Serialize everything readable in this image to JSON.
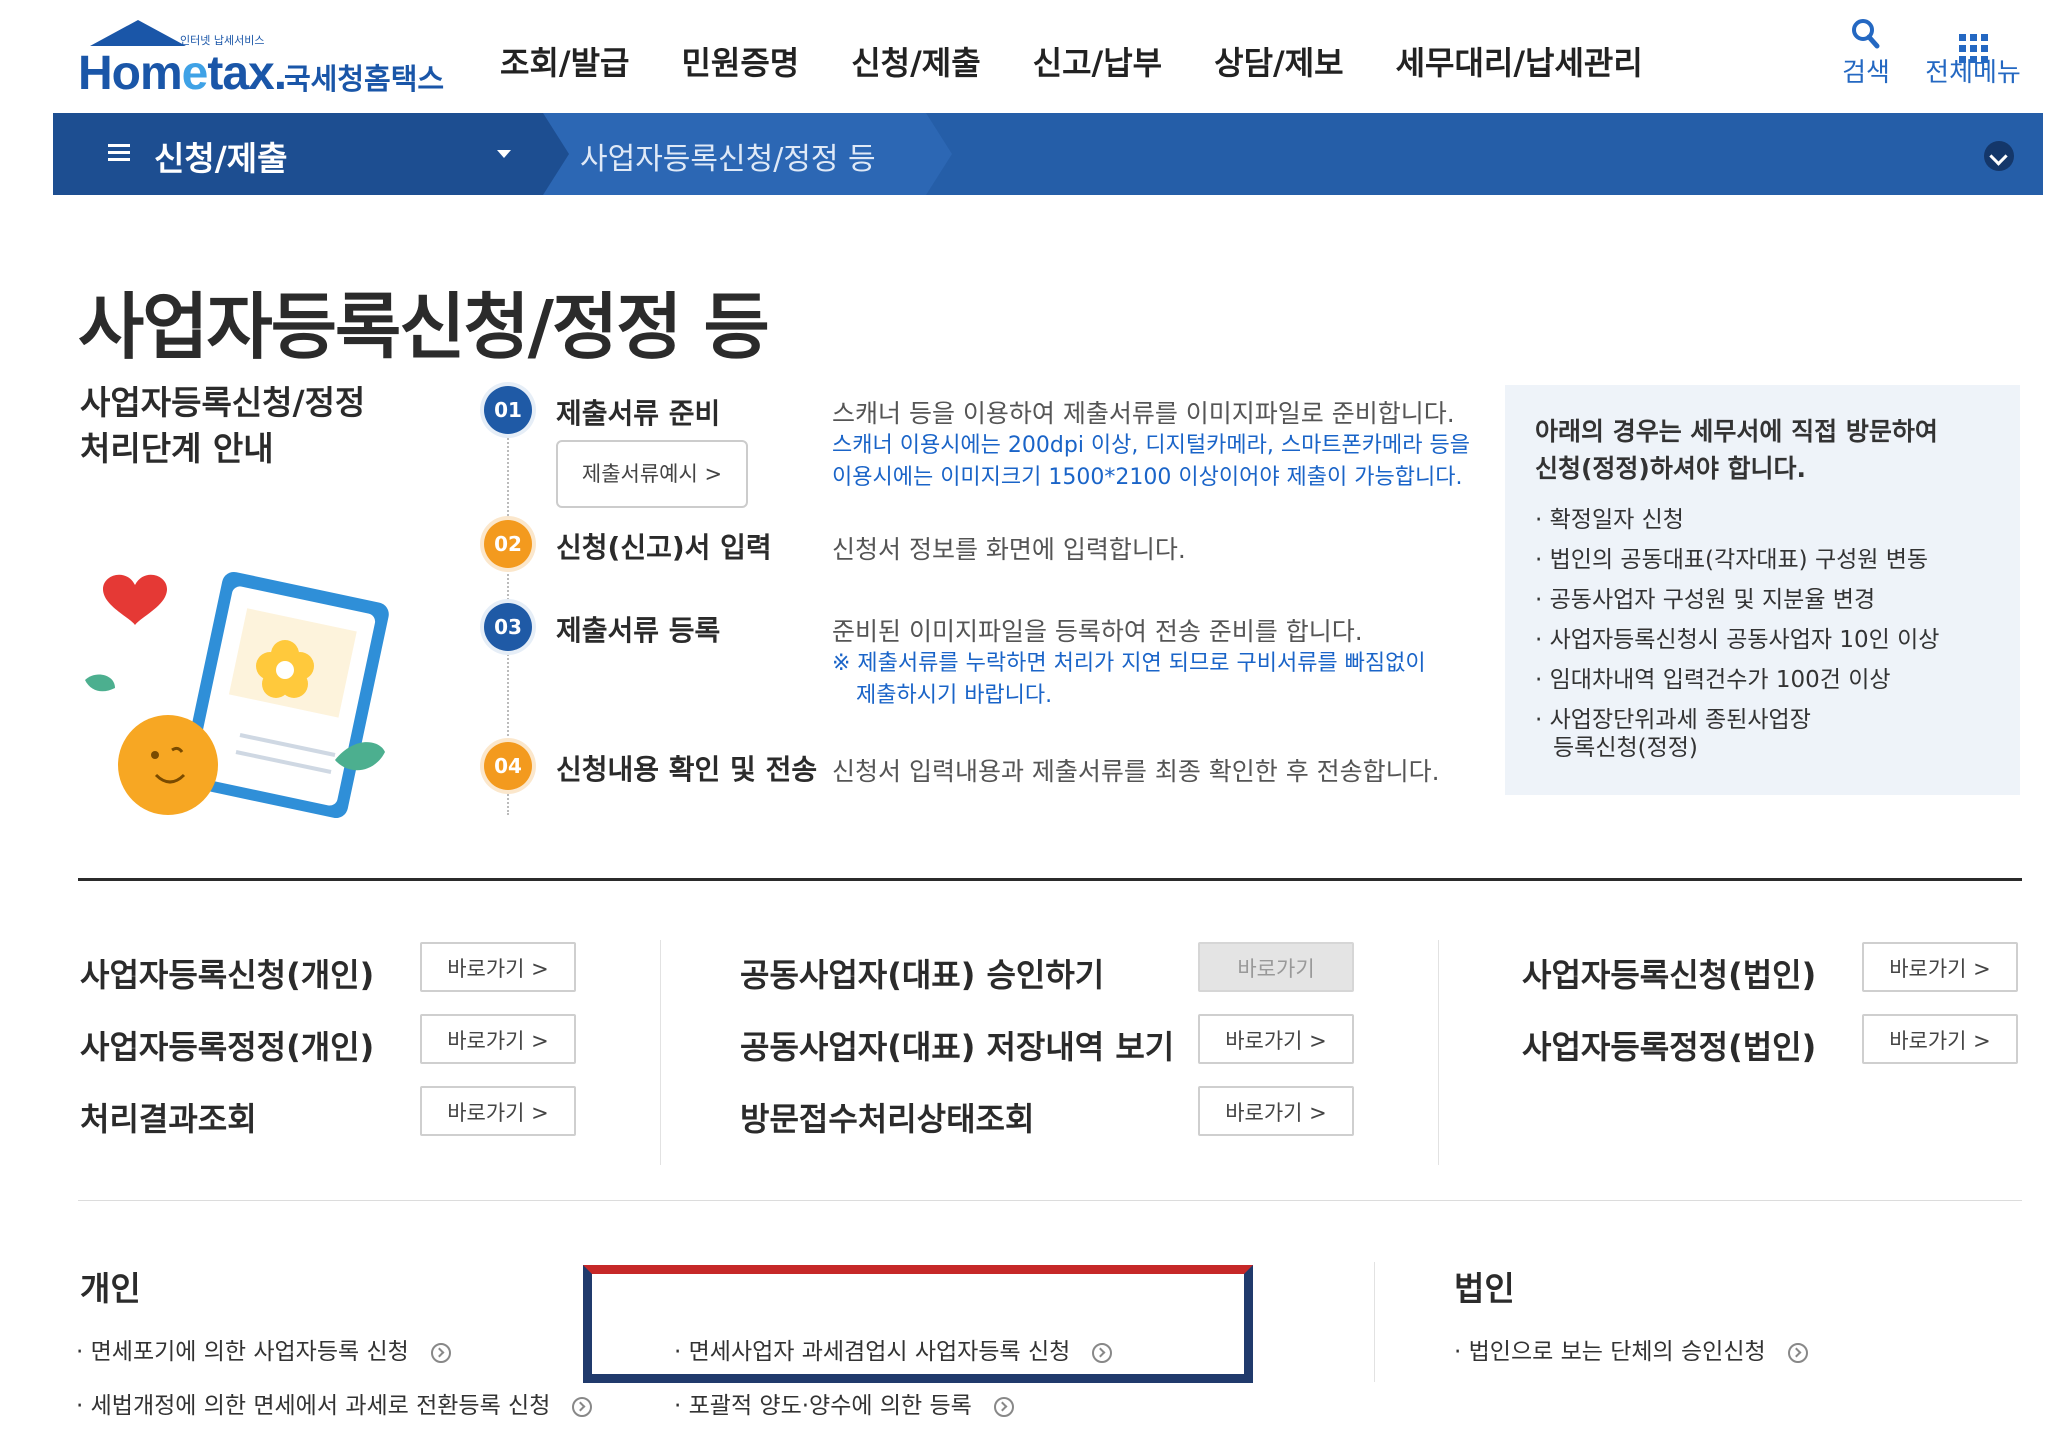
{
  "header": {
    "logo_small": "인터넷 납세서비스",
    "logo_main_a": "Hom",
    "logo_main_b": "e",
    "logo_main_c": "tax.",
    "logo_kr": "국세청홈택스",
    "nav": [
      "조회/발급",
      "민원증명",
      "신청/제출",
      "신고/납부",
      "상담/제보",
      "세무대리/납세관리"
    ],
    "search_label": "검색",
    "allmenu_label": "전체메뉴"
  },
  "location": {
    "level1": "신청/제출",
    "level2": "사업자등록신청/정정 등"
  },
  "page_title": "사업자등록신청/정정 등",
  "guide": {
    "title_line1": "사업자등록신청/정정",
    "title_line2": "처리단계 안내",
    "steps": [
      {
        "no": "01",
        "title": "제출서류 준비",
        "desc": "스캐너 등을 이용하여 제출서류를 이미지파일로 준비합니다.",
        "note_line1": "스캐너 이용시에는 200dpi 이상, 디지털카메라, 스마트폰카메라 등을",
        "note_line2": "이용시에는 이미지크기 1500*2100 이상이어야 제출이 가능합니다.",
        "button": "제출서류예시 >"
      },
      {
        "no": "02",
        "title": "신청(신고)서 입력",
        "desc": "신청서 정보를 화면에 입력합니다."
      },
      {
        "no": "03",
        "title": "제출서류 등록",
        "desc": "준비된 이미지파일을 등록하여 전송 준비를 합니다.",
        "note_line1": "※ 제출서류를 누락하면 처리가 지연 되므로 구비서류를 빠짐없이",
        "note_line2": "제출하시기 바랍니다."
      },
      {
        "no": "04",
        "title": "신청내용 확인 및 전송",
        "desc": "신청서 입력내용과 제출서류를 최종 확인한 후 전송합니다."
      }
    ],
    "visit": {
      "head_line1": "아래의 경우는 세무서에 직접 방문하여",
      "head_line2": "신청(정정)하셔야 합니다.",
      "items": [
        "확정일자 신청",
        "법인의 공동대표(각자대표) 구성원 변동",
        "공동사업자 구성원 및 지분율 변경",
        "사업자등록신청시 공동사업자 10인 이상",
        "임대차내역 입력건수가 100건 이상"
      ],
      "item_last_line1": "사업장단위과세 종된사업장",
      "item_last_line2": "등록신청(정정)"
    }
  },
  "shortcuts": {
    "button_label": "바로가기 >",
    "disabled_label": "바로가기",
    "col1": [
      "사업자등록신청(개인)",
      "사업자등록정정(개인)",
      "처리결과조회"
    ],
    "col2": [
      "공동사업자(대표) 승인하기",
      "공동사업자(대표) 저장내역 보기",
      "방문접수처리상태조회"
    ],
    "col3": [
      "사업자등록신청(법인)",
      "사업자등록정정(법인)"
    ]
  },
  "bottom": {
    "personal_head": "개인",
    "corp_head": "법인",
    "links": {
      "p1": "· 면세포기에 의한 사업자등록 신청",
      "p2": "· 세법개정에 의한 면세에서 과세로 전환등록 신청",
      "m1": "· 면세사업자 과세겸업시 사업자등록 신청",
      "m2": "· 포괄적 양도·양수에 의한 등록",
      "c1": "· 법인으로 보는 단체의 승인신청"
    }
  }
}
